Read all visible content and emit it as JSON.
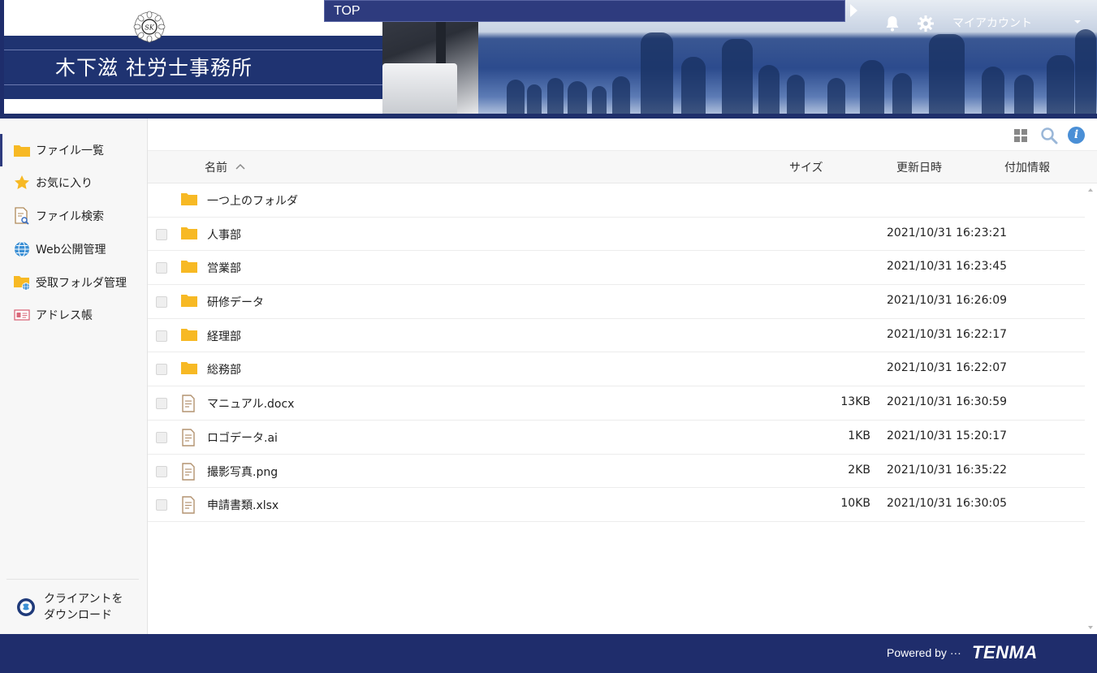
{
  "header": {
    "company_name": "木下滋 社労士事務所",
    "emblem_text": "SK",
    "top_nav_label": "TOP",
    "account_label": "マイアカウント",
    "icons": [
      "bell-icon",
      "gear-icon",
      "chevron-down-icon"
    ]
  },
  "sidebar": {
    "items": [
      {
        "label": "ファイル一覧",
        "icon": "folder-icon",
        "active": true
      },
      {
        "label": "お気に入り",
        "icon": "star-icon",
        "active": false
      },
      {
        "label": "ファイル検索",
        "icon": "file-search-icon",
        "active": false
      },
      {
        "label": "Web公開管理",
        "icon": "globe-icon",
        "active": false
      },
      {
        "label": "受取フォルダ管理",
        "icon": "folder-globe-icon",
        "active": false
      },
      {
        "label": "アドレス帳",
        "icon": "address-card-icon",
        "active": false
      }
    ],
    "client_download_line1": "クライアントを",
    "client_download_line2": "ダウンロード"
  },
  "toolbar": {
    "icons": [
      "grid-view-icon",
      "search-icon",
      "info-icon"
    ],
    "info_glyph": "i"
  },
  "columns": {
    "name": "名前",
    "size": "サイズ",
    "date": "更新日時",
    "info": "付加情報"
  },
  "files": [
    {
      "name": "一つ上のフォルダ",
      "type": "parent",
      "size": "",
      "date": ""
    },
    {
      "name": "人事部",
      "type": "folder",
      "size": "",
      "date": "2021/10/31 16:23:21"
    },
    {
      "name": "営業部",
      "type": "folder",
      "size": "",
      "date": "2021/10/31 16:23:45"
    },
    {
      "name": "研修データ",
      "type": "folder",
      "size": "",
      "date": "2021/10/31 16:26:09"
    },
    {
      "name": "経理部",
      "type": "folder",
      "size": "",
      "date": "2021/10/31 16:22:17"
    },
    {
      "name": "総務部",
      "type": "folder",
      "size": "",
      "date": "2021/10/31 16:22:07"
    },
    {
      "name": "マニュアル.docx",
      "type": "file",
      "size": "13KB",
      "date": "2021/10/31 16:30:59"
    },
    {
      "name": "ロゴデータ.ai",
      "type": "file",
      "size": "1KB",
      "date": "2021/10/31 15:20:17"
    },
    {
      "name": "撮影写真.png",
      "type": "file",
      "size": "2KB",
      "date": "2021/10/31 16:35:22"
    },
    {
      "name": "申請書類.xlsx",
      "type": "file",
      "size": "10KB",
      "date": "2021/10/31 16:30:05"
    }
  ],
  "footer": {
    "powered_by": "Powered by ···",
    "logo_text": "TENMA"
  },
  "colors": {
    "navy": "#1f2d6c",
    "folder": "#f7b924",
    "accent_blue": "#4a8fd6"
  }
}
